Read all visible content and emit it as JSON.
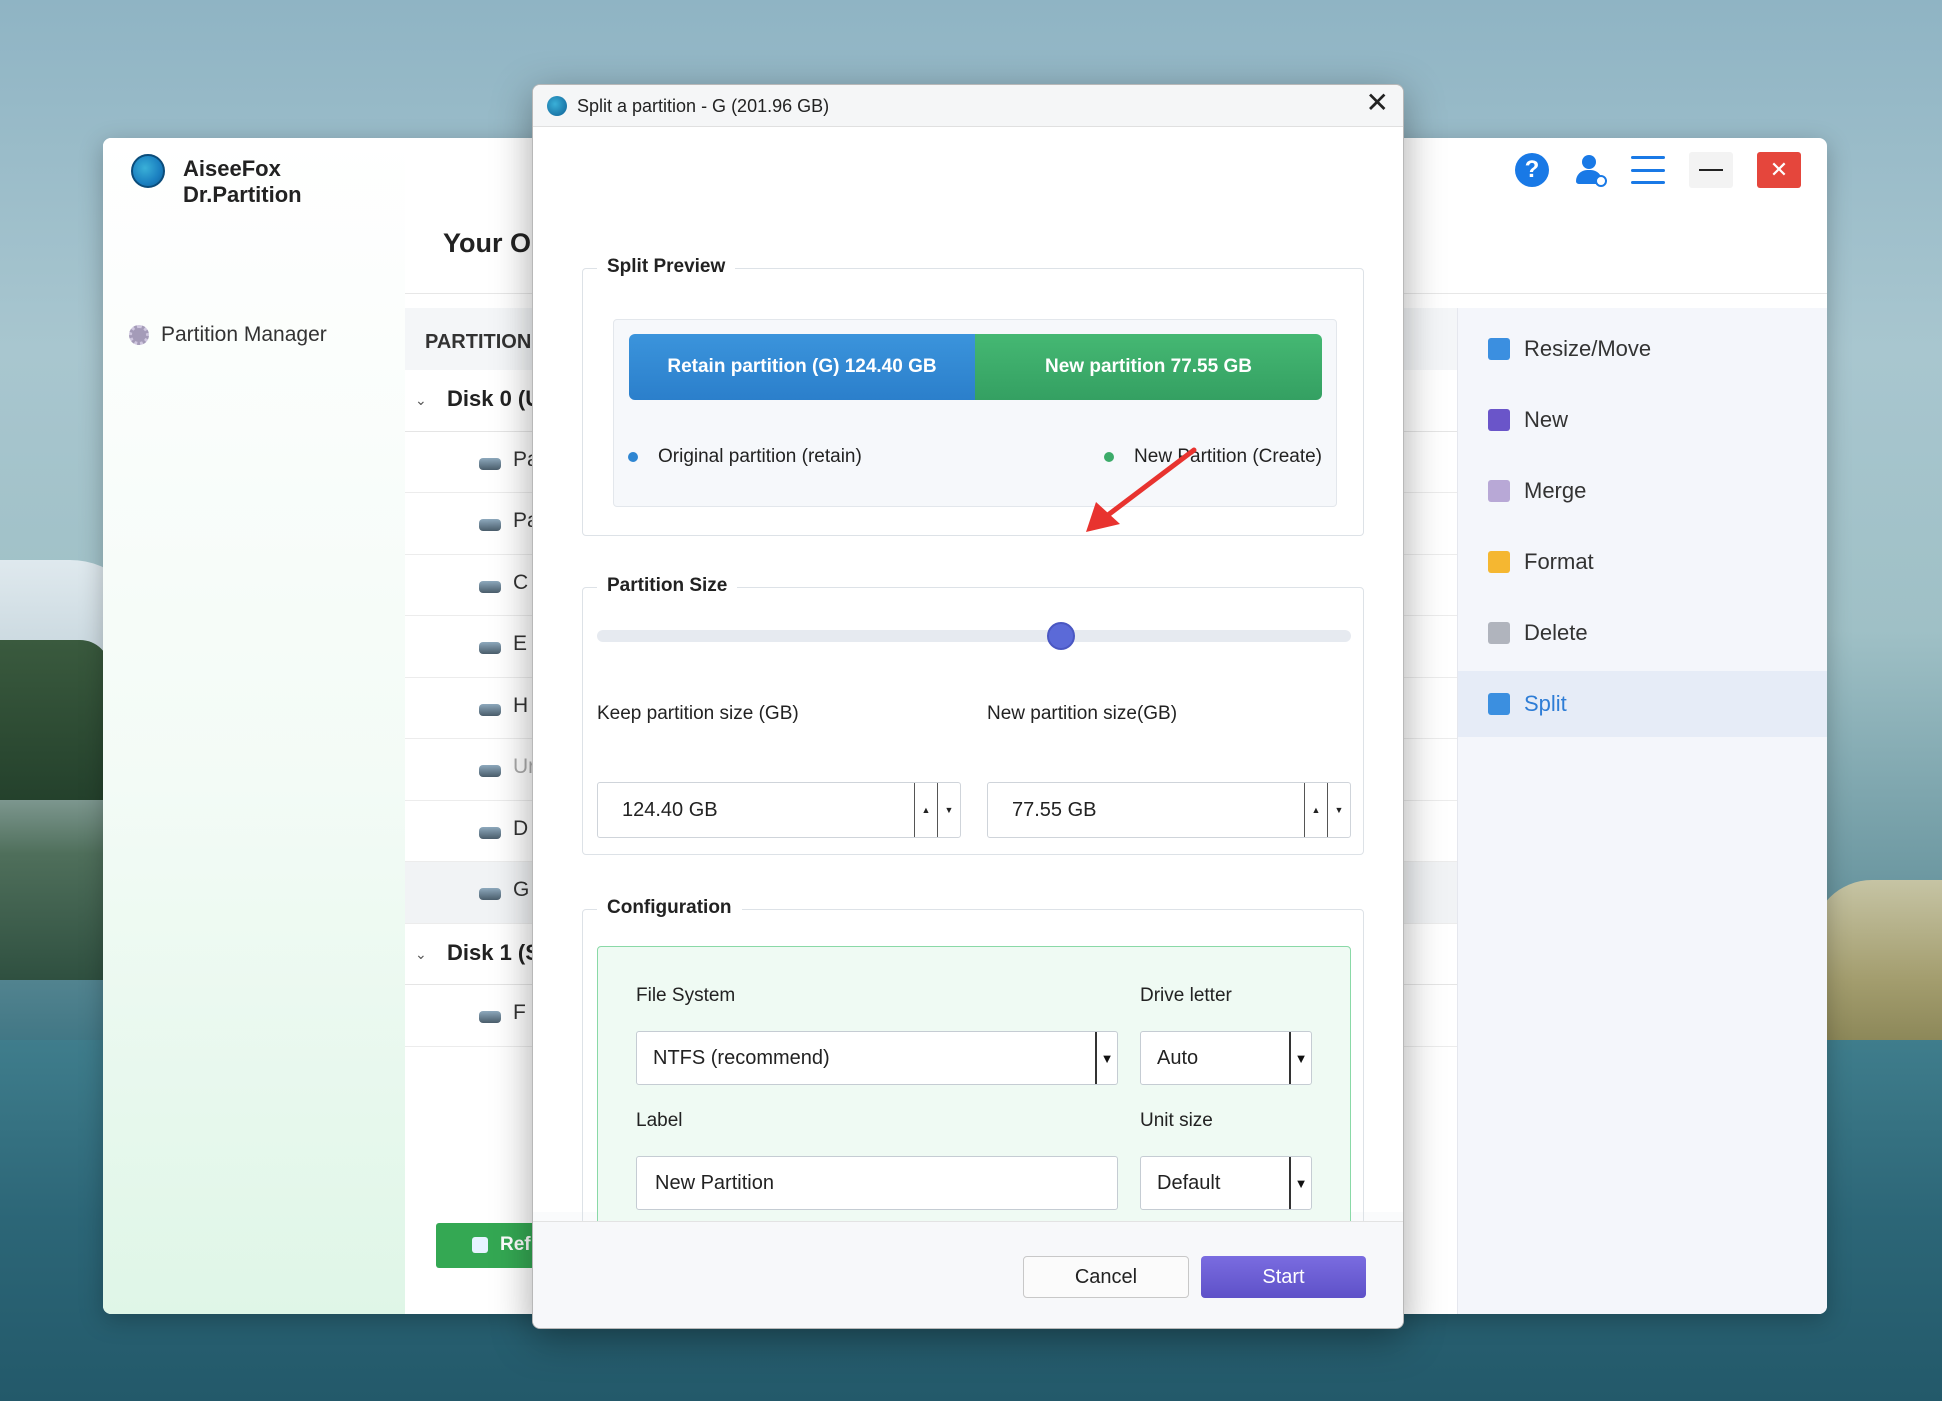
{
  "app": {
    "title": "AiseeFox Dr.Partition",
    "heading": "Your O",
    "sidebar_item": "Partition Manager",
    "table_header": "PARTITION",
    "refresh_label": "Ref",
    "tree": [
      {
        "type": "disk",
        "label": "Disk 0 (U"
      },
      {
        "type": "part",
        "label": "Pa"
      },
      {
        "type": "part",
        "label": "Pa"
      },
      {
        "type": "part",
        "label": "C"
      },
      {
        "type": "part",
        "label": "E"
      },
      {
        "type": "part",
        "label": "H"
      },
      {
        "type": "part",
        "label": "Ur",
        "dim": true
      },
      {
        "type": "part",
        "label": "D"
      },
      {
        "type": "part",
        "label": "G",
        "selected": true
      },
      {
        "type": "disk",
        "label": "Disk 1 (S"
      },
      {
        "type": "part",
        "label": "F"
      }
    ],
    "operations": [
      {
        "label": "Resize/Move",
        "icon": "resize-icon",
        "color": "#3b8fe0"
      },
      {
        "label": "New",
        "icon": "plus-icon",
        "color": "#6a55c9"
      },
      {
        "label": "Merge",
        "icon": "link-icon",
        "color": "#b8a8d6"
      },
      {
        "label": "Format",
        "icon": "folder-icon",
        "color": "#f5b731"
      },
      {
        "label": "Delete",
        "icon": "trash-icon",
        "color": "#b0b4bd"
      },
      {
        "label": "Split",
        "icon": "split-icon",
        "color": "#3b8fe0",
        "active": true
      }
    ],
    "window_icons": [
      "help-icon",
      "add-user-icon",
      "menu-icon",
      "minimize-icon",
      "close-icon"
    ]
  },
  "dialog": {
    "title": "Split a partition - G (201.96 GB)",
    "split_preview": {
      "title": "Split Preview",
      "retain_bar": "Retain partition (G) 124.40 GB",
      "new_bar": "New partition 77.55 GB",
      "legend_retain": "Original partition (retain)",
      "legend_new": "New Partition (Create)",
      "retain_color": "#2e86d2",
      "new_color": "#3cab69"
    },
    "partition_size": {
      "title": "Partition Size",
      "slider_fraction": 0.616,
      "keep_label": "Keep partition size (GB)",
      "new_label": "New partition size(GB)",
      "keep_value": "124.40 GB",
      "new_value": "77.55 GB"
    },
    "configuration": {
      "title": "Configuration",
      "file_system_label": "File System",
      "file_system_value": "NTFS (recommend)",
      "drive_letter_label": "Drive letter",
      "drive_letter_value": "Auto",
      "label_label": "Label",
      "label_value": "New Partition",
      "unit_size_label": "Unit size",
      "unit_size_value": "Default"
    },
    "cancel_label": "Cancel",
    "start_label": "Start"
  }
}
